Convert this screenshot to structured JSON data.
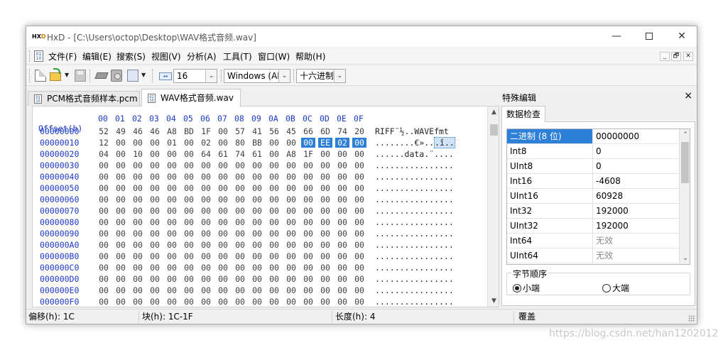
{
  "window": {
    "app_name": "HxD",
    "title": "HxD - [C:\\Users\\octop\\Desktop\\WAV格式音频.wav]",
    "minimize_glyph": "—",
    "close_glyph": "✕"
  },
  "menu": {
    "items": [
      "文件(F)",
      "编辑(E)",
      "搜索(S)",
      "视图(V)",
      "分析(A)",
      "工具(T)",
      "窗口(W)",
      "帮助(H)"
    ],
    "mdi_buttons": [
      "_",
      "🗗",
      "✕"
    ]
  },
  "toolbar": {
    "bytes_per_row": "16",
    "charset": "Windows (ANSI)",
    "offset_base": "十六进制"
  },
  "tabs": [
    {
      "label": "PCM格式音频样本.pcm",
      "active": false
    },
    {
      "label": "WAV格式音频.wav",
      "active": true
    }
  ],
  "hex": {
    "header_label": "Offset(h)",
    "columns": [
      "00",
      "01",
      "02",
      "03",
      "04",
      "05",
      "06",
      "07",
      "08",
      "09",
      "0A",
      "0B",
      "0C",
      "0D",
      "0E",
      "0F"
    ],
    "rows": [
      {
        "offset": "00000000",
        "bytes": [
          "52",
          "49",
          "46",
          "46",
          "A8",
          "BD",
          "1F",
          "00",
          "57",
          "41",
          "56",
          "45",
          "66",
          "6D",
          "74",
          "20"
        ],
        "text": "RIFF¨½..WAVEfmt "
      },
      {
        "offset": "00000010",
        "bytes": [
          "12",
          "00",
          "00",
          "00",
          "01",
          "00",
          "02",
          "00",
          "80",
          "BB",
          "00",
          "00",
          "00",
          "EE",
          "02",
          "00"
        ],
        "text": "........€»..",
        "text_selected": ".î.."
      },
      {
        "offset": "00000020",
        "bytes": [
          "04",
          "00",
          "10",
          "00",
          "00",
          "00",
          "64",
          "61",
          "74",
          "61",
          "00",
          "A8",
          "1F",
          "00",
          "00",
          "00"
        ],
        "text": "......data.¨...."
      },
      {
        "offset": "00000030",
        "bytes": [
          "00",
          "00",
          "00",
          "00",
          "00",
          "00",
          "00",
          "00",
          "00",
          "00",
          "00",
          "00",
          "00",
          "00",
          "00",
          "00"
        ],
        "text": "................"
      },
      {
        "offset": "00000040",
        "bytes": [
          "00",
          "00",
          "00",
          "00",
          "00",
          "00",
          "00",
          "00",
          "00",
          "00",
          "00",
          "00",
          "00",
          "00",
          "00",
          "00"
        ],
        "text": "................"
      },
      {
        "offset": "00000050",
        "bytes": [
          "00",
          "00",
          "00",
          "00",
          "00",
          "00",
          "00",
          "00",
          "00",
          "00",
          "00",
          "00",
          "00",
          "00",
          "00",
          "00"
        ],
        "text": "................"
      },
      {
        "offset": "00000060",
        "bytes": [
          "00",
          "00",
          "00",
          "00",
          "00",
          "00",
          "00",
          "00",
          "00",
          "00",
          "00",
          "00",
          "00",
          "00",
          "00",
          "00"
        ],
        "text": "................"
      },
      {
        "offset": "00000070",
        "bytes": [
          "00",
          "00",
          "00",
          "00",
          "00",
          "00",
          "00",
          "00",
          "00",
          "00",
          "00",
          "00",
          "00",
          "00",
          "00",
          "00"
        ],
        "text": "................"
      },
      {
        "offset": "00000080",
        "bytes": [
          "00",
          "00",
          "00",
          "00",
          "00",
          "00",
          "00",
          "00",
          "00",
          "00",
          "00",
          "00",
          "00",
          "00",
          "00",
          "00"
        ],
        "text": "................"
      },
      {
        "offset": "00000090",
        "bytes": [
          "00",
          "00",
          "00",
          "00",
          "00",
          "00",
          "00",
          "00",
          "00",
          "00",
          "00",
          "00",
          "00",
          "00",
          "00",
          "00"
        ],
        "text": "................"
      },
      {
        "offset": "000000A0",
        "bytes": [
          "00",
          "00",
          "00",
          "00",
          "00",
          "00",
          "00",
          "00",
          "00",
          "00",
          "00",
          "00",
          "00",
          "00",
          "00",
          "00"
        ],
        "text": "................"
      },
      {
        "offset": "000000B0",
        "bytes": [
          "00",
          "00",
          "00",
          "00",
          "00",
          "00",
          "00",
          "00",
          "00",
          "00",
          "00",
          "00",
          "00",
          "00",
          "00",
          "00"
        ],
        "text": "................"
      },
      {
        "offset": "000000C0",
        "bytes": [
          "00",
          "00",
          "00",
          "00",
          "00",
          "00",
          "00",
          "00",
          "00",
          "00",
          "00",
          "00",
          "00",
          "00",
          "00",
          "00"
        ],
        "text": "................"
      },
      {
        "offset": "000000D0",
        "bytes": [
          "00",
          "00",
          "00",
          "00",
          "00",
          "00",
          "00",
          "00",
          "00",
          "00",
          "00",
          "00",
          "00",
          "00",
          "00",
          "00"
        ],
        "text": "................"
      },
      {
        "offset": "000000E0",
        "bytes": [
          "00",
          "00",
          "00",
          "00",
          "00",
          "00",
          "00",
          "00",
          "00",
          "00",
          "00",
          "00",
          "00",
          "00",
          "00",
          "00"
        ],
        "text": "................"
      },
      {
        "offset": "000000F0",
        "bytes": [
          "00",
          "00",
          "00",
          "00",
          "00",
          "00",
          "00",
          "00",
          "00",
          "00",
          "00",
          "00",
          "00",
          "00",
          "00",
          "00"
        ],
        "text": "................"
      }
    ],
    "selection": {
      "row": 1,
      "from": 12,
      "to": 15
    }
  },
  "inspector": {
    "panel_title": "特殊编辑",
    "tab_label": "数据检查",
    "rows": [
      {
        "name": "二进制 (8 位)",
        "value": "00000000",
        "selected": true
      },
      {
        "name": "Int8",
        "value": "0"
      },
      {
        "name": "UInt8",
        "value": "0"
      },
      {
        "name": "Int16",
        "value": "-4608"
      },
      {
        "name": "UInt16",
        "value": "60928"
      },
      {
        "name": "Int32",
        "value": "192000"
      },
      {
        "name": "UInt32",
        "value": "192000"
      },
      {
        "name": "Int64",
        "value": "无效",
        "muted": true
      },
      {
        "name": "UInt64",
        "value": "无效",
        "muted": true
      }
    ],
    "byte_order_label": "字节顺序",
    "little_endian": "小端",
    "big_endian": "大端",
    "selected_order": "little"
  },
  "status": {
    "offset": "偏移(h): 1C",
    "block": "块(h): 1C-1F",
    "length": "长度(h): 4",
    "mode": "覆盖"
  },
  "watermark": "https://blog.csdn.net/han1202012"
}
